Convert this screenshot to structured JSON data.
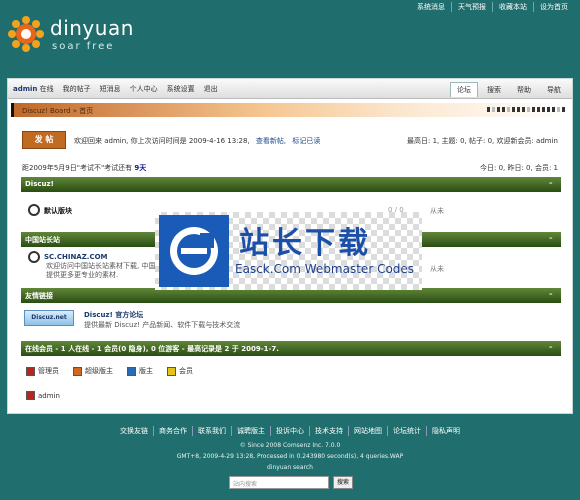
{
  "header": {
    "brand": "dinyuan",
    "slogan": "soar free",
    "toplinks": [
      "系统消息",
      "天气预报",
      "收藏本站",
      "设为首页"
    ]
  },
  "nav": {
    "user": "admin",
    "status": "在线",
    "links": [
      "我的帖子",
      "短消息",
      "个人中心",
      "系统设置",
      "退出"
    ],
    "tabs": [
      "论坛",
      "搜索",
      "帮助",
      "导航"
    ]
  },
  "breadcrumb": "Discuz! Board » 首页",
  "post_button": "发 帖",
  "welcome": {
    "text": "欢迎回来 admin, 你上次访问时间是 2009-4-16 13:28,",
    "new_posts": "查看新帖,",
    "mark_read": "标记已读"
  },
  "stats": "最高日: 1, 主题: 0, 帖子: 0, 欢迎新会员: admin",
  "countdown": {
    "text": "距2009年5月9日\"考试不\"考试还有",
    "days": "9天"
  },
  "today": "今日: 0, 昨日: 0, 会员: 1",
  "sections": [
    {
      "title": "Discuz!",
      "forum": {
        "name": "默认版块",
        "desc": "",
        "count": "0 / 0",
        "from": "从未"
      }
    },
    {
      "title": "中国站长站",
      "forum": {
        "name": "SC.CHINAZ.COM",
        "desc": "欢迎访问中国站长站素材下载, 中国",
        "desc2": "提供更多更专业的素材.",
        "count": "",
        "from": "从未"
      }
    },
    {
      "title": "友情链接",
      "partner": {
        "logo": "Discuz.net",
        "name": "Discuz! 官方论坛",
        "desc": "提供最新 Discuz! 产品新闻、软件下载与技术交流"
      }
    },
    {
      "title": "在线会员 - 1 人在线 - 1 会员(0 隐身), 0 位游客 - 最高记录是 2 于 2009-1-7."
    }
  ],
  "legend": [
    {
      "label": "管理员",
      "color": "#b5261e"
    },
    {
      "label": "超级版主",
      "color": "#d06a1e"
    },
    {
      "label": "版主",
      "color": "#2a6bb5"
    },
    {
      "label": "会员",
      "color": "#e2c41a"
    }
  ],
  "online_user": "admin",
  "footer": {
    "links": [
      "交换友链",
      "商务合作",
      "联系我们",
      "诚聘版主",
      "投诉中心",
      "技术支持",
      "网站地图",
      "论坛统计",
      "隐私声明"
    ],
    "copyright": "© Since 2008 Comsenz Inc. 7.0.0",
    "runtime": "GMT+8, 2009-4-29 13:28, Processed in 0.243980 second(s), 4 queries.WAP",
    "site": "dinyuan search",
    "search_placeholder": "站内搜索",
    "search_button": "搜索"
  },
  "watermark": {
    "title": "站长下载",
    "subtitle": "Easck.Com Webmaster Codes"
  }
}
